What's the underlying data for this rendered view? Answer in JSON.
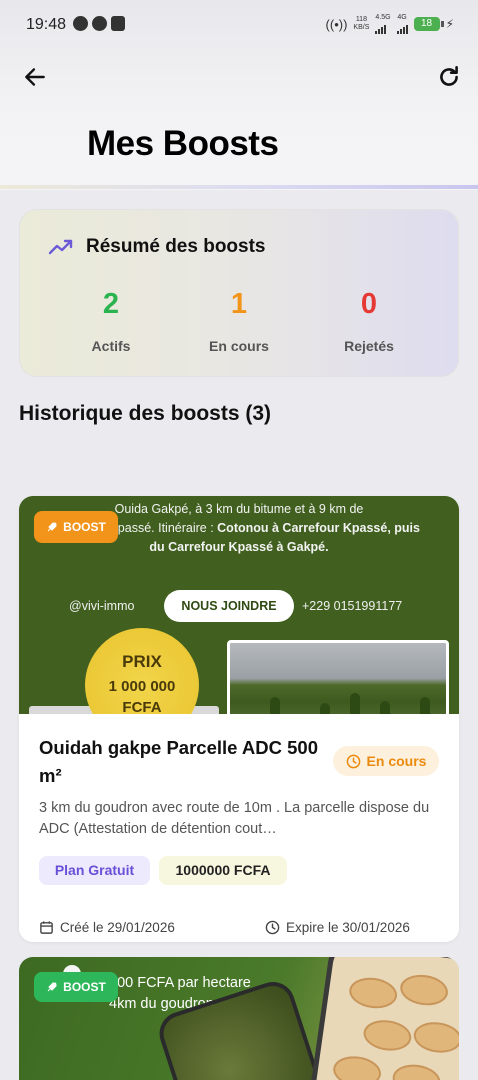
{
  "status_bar": {
    "time": "19:48",
    "net_speed_top": "118",
    "net_speed_unit": "KB/S",
    "net_type_1": "4.5G",
    "net_type_2": "4G",
    "battery": "18"
  },
  "header": {
    "title": "Mes Boosts"
  },
  "summary": {
    "title": "Résumé des boosts",
    "stats": [
      {
        "value": "2",
        "label": "Actifs",
        "color": "#2bb34f"
      },
      {
        "value": "1",
        "label": "En cours",
        "color": "#f2931a"
      },
      {
        "value": "0",
        "label": "Rejetés",
        "color": "#e53935"
      }
    ]
  },
  "history": {
    "title": "Historique des boosts (3)"
  },
  "boosts": [
    {
      "badge": "BOOST",
      "badge_color": "#f2931a",
      "image_text_prefix": "Ouida Gakpé, à 3 km du bitume et à 9 km de",
      "image_text_line2": "...che de Kpassé. Itinéraire :",
      "image_text_bold": "Cotonou à Carrefour Kpassé, puis du Carrefour Kpassé à Gakpé.",
      "image_handle": "@vivi-immo",
      "image_join": "NOUS JOINDRE",
      "image_phone": "+229 0151991177",
      "image_price_label": "PRIX",
      "image_price_value": "1 000 000",
      "image_price_unit": "FCFA",
      "title": "Ouidah gakpe Parcelle ADC 500 m²",
      "status": "En cours",
      "status_color": "#ea8a0e",
      "description": "3 km du goudron avec route de 10m . La parcelle dispose du ADC (Attestation de détention cout…",
      "plan": "Plan Gratuit",
      "price": "1000000 FCFA",
      "created": "Créé le 29/01/2026",
      "expires": "Expire le 30/01/2026"
    },
    {
      "badge": "BOOST",
      "badge_color": "#2eb75a",
      "image_text_line1": "000 FCFA par hectare",
      "image_text_line2": "4km du goudron"
    }
  ]
}
